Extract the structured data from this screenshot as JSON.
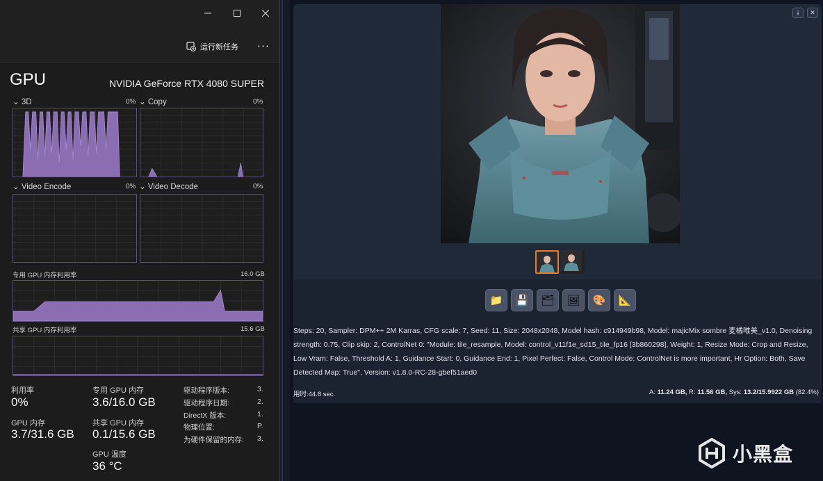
{
  "task_manager": {
    "run_task_label": "运行新任务",
    "more_label": "···",
    "gpu_title": "GPU",
    "gpu_model": "NVIDIA GeForce RTX 4080 SUPER",
    "engines": [
      {
        "label": "3D",
        "pct": "0%"
      },
      {
        "label": "Copy",
        "pct": "0%"
      },
      {
        "label": "Video Encode",
        "pct": "0%"
      },
      {
        "label": "Video Decode",
        "pct": "0%"
      }
    ],
    "dedicated_mem": {
      "label": "专用 GPU 内存利用率",
      "max": "16.0 GB"
    },
    "shared_mem": {
      "label": "共享 GPU 内存利用率",
      "max": "15.6 GB"
    },
    "stats": {
      "util_label": "利用率",
      "util_value": "0%",
      "gpu_mem_label": "GPU 内存",
      "gpu_mem_value": "3.7/31.6 GB",
      "ded_label": "专用 GPU 内存",
      "ded_value": "3.6/16.0 GB",
      "shared_label": "共享 GPU 内存",
      "shared_value": "0.1/15.6 GB",
      "temp_label": "GPU 温度",
      "temp_value": "36 °C"
    },
    "driver": [
      {
        "label": "驱动程序版本:",
        "value": "3."
      },
      {
        "label": "驱动程序日期:",
        "value": "2."
      },
      {
        "label": "DirectX 版本:",
        "value": "1."
      },
      {
        "label": "物理位置:",
        "value": "P."
      },
      {
        "label": "为硬件保留的内存:",
        "value": "3."
      }
    ]
  },
  "webui": {
    "gen_info": "Steps: 20, Sampler: DPM++ 2M Karras, CFG scale: 7, Seed: 11, Size: 2048x2048, Model hash: c914949b98, Model: majicMix sombre 麦橘唯美_v1.0, Denoising strength: 0.75, Clip skip: 2, ControlNet 0: \"Module: tile_resample, Model: control_v11f1e_sd15_tile_fp16 [3b860298], Weight: 1, Resize Mode: Crop and Resize, Low Vram: False, Threshold A: 1, Guidance Start: 0, Guidance End: 1, Pixel Perfect: False, Control Mode: ControlNet is more important, Hr Option: Both, Save Detected Map: True\", Version: v1.8.0-RC-28-gbef51aed0",
    "time_label": "用时:44.8 sec.",
    "vram": {
      "a_label": "A:",
      "a_value": "11.24 GB,",
      "r_label": "R:",
      "r_value": "11.56 GB,",
      "sys_label": "Sys:",
      "sys_value": "13.2/15.9922 GB",
      "pct": "(82.4%)"
    },
    "tool_icons": [
      "folder-icon",
      "save-icon",
      "zip-icon",
      "image-icon",
      "palette-icon",
      "ruler-icon"
    ]
  },
  "watermark": {
    "text": "小黑盒"
  },
  "colors": {
    "graph_fill": "#8b6db3",
    "graph_border": "#5a4f78",
    "accent_selected": "#ea7b2a"
  }
}
